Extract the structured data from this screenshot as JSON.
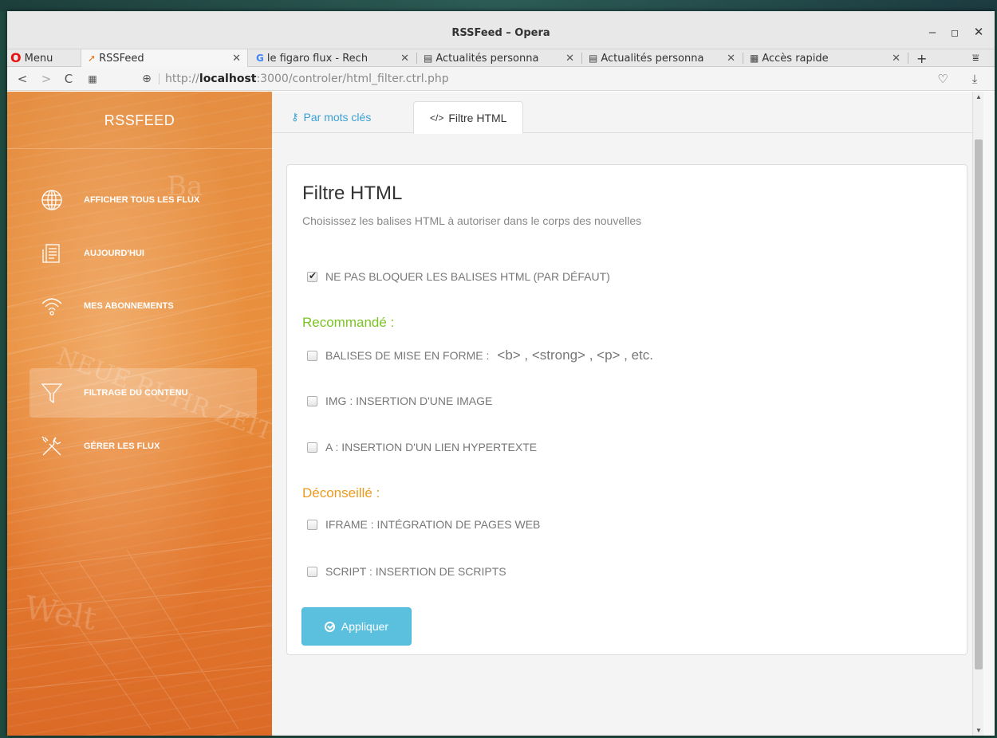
{
  "window": {
    "title": "RSSFeed – Opera",
    "min": "–",
    "max": "◻",
    "close": "✕"
  },
  "browser": {
    "menu_label": "Menu",
    "tabs": [
      {
        "label": "RSSFeed",
        "close": "✕"
      },
      {
        "label": "le figaro flux - Rech",
        "close": "✕"
      },
      {
        "label": "Actualités personna",
        "close": "✕"
      },
      {
        "label": "Actualités personna",
        "close": "✕"
      },
      {
        "label": "Accès rapide",
        "close": "✕"
      }
    ],
    "new_tab": "+",
    "url_prefix": "http://",
    "url_host": "localhost",
    "url_rest": ":3000/controler/html_filter.ctrl.php"
  },
  "sidebar": {
    "brand": "RSSFEED",
    "items": [
      {
        "label": "AFFICHER TOUS LES FLUX",
        "icon": "globe-icon"
      },
      {
        "label": "AUJOURD'HUI",
        "icon": "newspaper-icon"
      },
      {
        "label": "MES ABONNEMENTS",
        "icon": "wifi-icon"
      },
      {
        "label": "FILTRAGE DU CONTENU",
        "icon": "filter-icon"
      },
      {
        "label": "GÉRER LES FLUX",
        "icon": "tools-icon"
      }
    ]
  },
  "content_tabs": [
    {
      "label": "Par mots clés",
      "icon": "key-icon"
    },
    {
      "label": "Filtre HTML",
      "icon": "code-icon"
    }
  ],
  "card": {
    "title": "Filtre HTML",
    "subtitle": "Choisissez les balises HTML à autoriser dans le corps des nouvelles",
    "default_option": {
      "label": "NE PAS BLOQUER LES BALISES HTML (PAR DÉFAUT)",
      "checked": true
    },
    "recommended_title": "Recommandé :",
    "recommended_color": "#7cc324",
    "recommended": [
      {
        "label": "BALISES DE MISE EN FORME :",
        "checked": false,
        "codes": "<b> ,  <strong> ,  <p> ,  etc."
      },
      {
        "label": "IMG : INSERTION D'UNE IMAGE",
        "checked": false
      },
      {
        "label": "A : INSERTION D'UN LIEN HYPERTEXTE",
        "checked": false
      }
    ],
    "discouraged_title": "Déconseillé :",
    "discouraged_color": "#eb9a1e",
    "discouraged": [
      {
        "label": "IFRAME : INTÉGRATION DE PAGES WEB",
        "checked": false
      },
      {
        "label": "SCRIPT : INSERTION DE SCRIPTS",
        "checked": false
      }
    ],
    "apply_label": "Appliquer"
  }
}
